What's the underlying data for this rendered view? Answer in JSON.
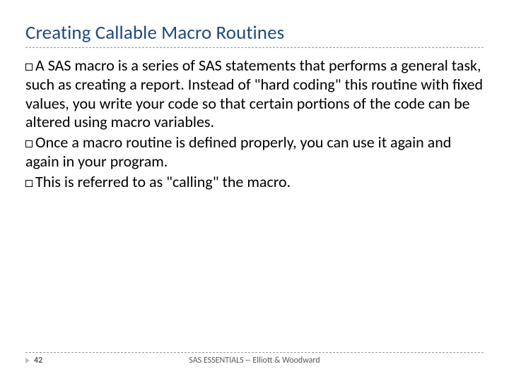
{
  "title": "Creating Callable Macro Routines",
  "bullets": [
    "A SAS macro is a series of SAS statements that performs a general task, such as creating a report. Instead of \"hard coding\" this routine with fixed values, you write your code so that certain portions of the code can be altered using macro variables.",
    "Once a macro routine is defined properly, you can use it again and again in your program.",
    "This is referred to as \"calling\" the macro."
  ],
  "page_number": "42",
  "footer_text": "SAS ESSENTIALS -- Elliott & Woodward"
}
